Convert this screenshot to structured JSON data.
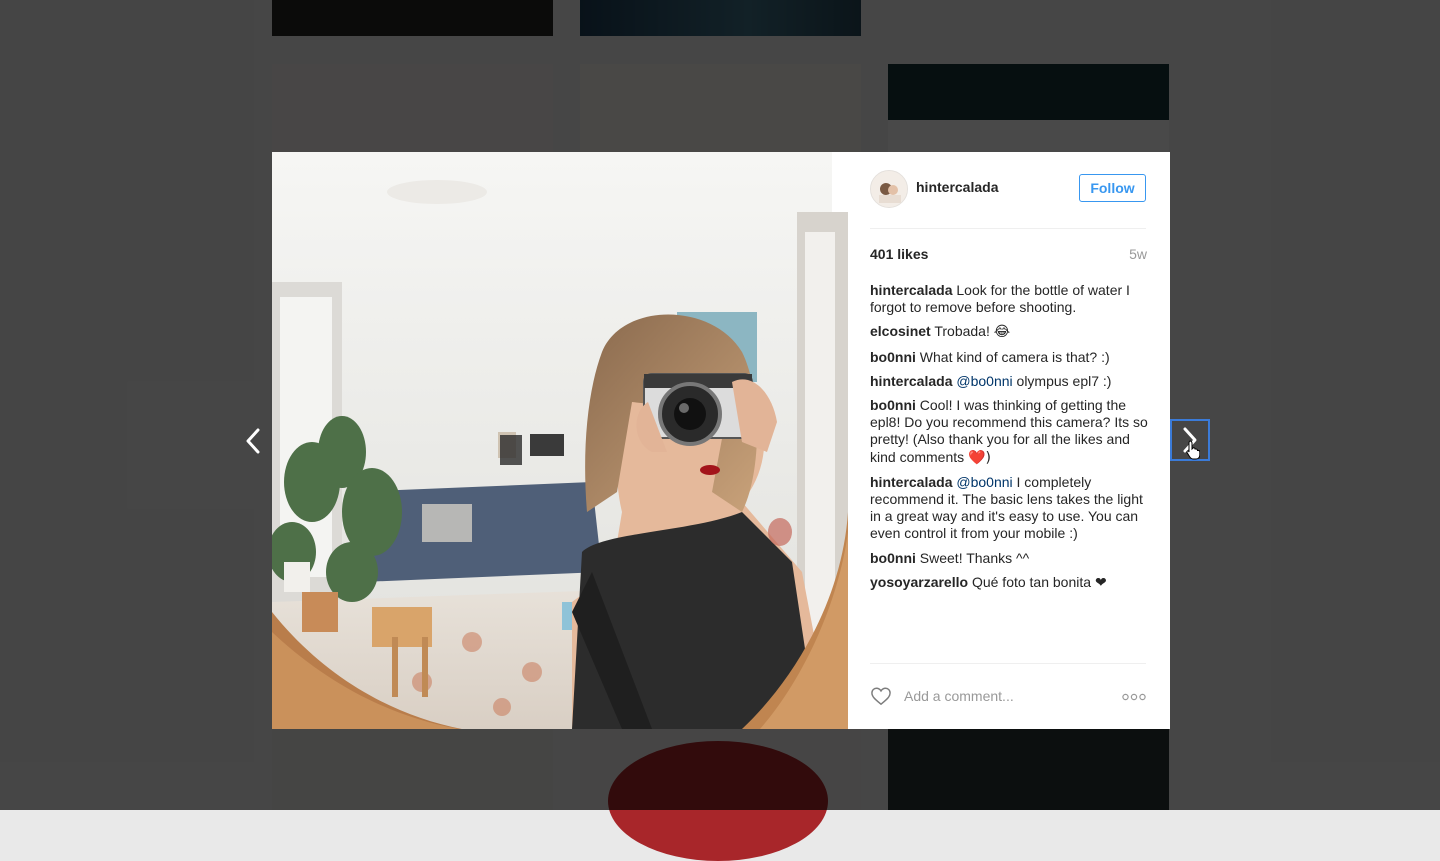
{
  "post": {
    "username": "hintercalada",
    "follow_label": "Follow",
    "likes": "401 likes",
    "age": "5w",
    "comments": [
      {
        "user": "hintercalada",
        "mention": "",
        "text": "Look for the bottle of water I forgot to remove before shooting.",
        "emoji": ""
      },
      {
        "user": "elcosinet",
        "mention": "",
        "text": "Trobada!",
        "emoji": "😂"
      },
      {
        "user": "bo0nni",
        "mention": "",
        "text": "What kind of camera is that? :)",
        "emoji": ""
      },
      {
        "user": "hintercalada",
        "mention": "@bo0nni",
        "text": "olympus epl7 :)",
        "emoji": ""
      },
      {
        "user": "bo0nni",
        "mention": "",
        "text": "Cool! I was thinking of getting the epl8! Do you recommend this camera? Its so pretty! (Also thank you for all the likes and kind comments",
        "emoji": "❤️)"
      },
      {
        "user": "hintercalada",
        "mention": "@bo0nni",
        "text": "I completely recommend it. The basic lens takes the light in a great way and it's easy to use. You can even control it from your mobile :)",
        "emoji": ""
      },
      {
        "user": "bo0nni",
        "mention": "",
        "text": "Sweet! Thanks ^^",
        "emoji": ""
      },
      {
        "user": "yosoyarzarello",
        "mention": "",
        "text": "Qué foto tan bonita",
        "emoji": "❤"
      }
    ],
    "add_comment_placeholder": "Add a comment..."
  },
  "icons": {
    "prev": "chevron-left-icon",
    "next": "chevron-right-icon",
    "like": "heart-icon",
    "more": "more-options-icon"
  },
  "colors": {
    "accent": "#3897f0",
    "mention": "#003569",
    "overlay": "rgba(0,0,0,0.7)"
  }
}
